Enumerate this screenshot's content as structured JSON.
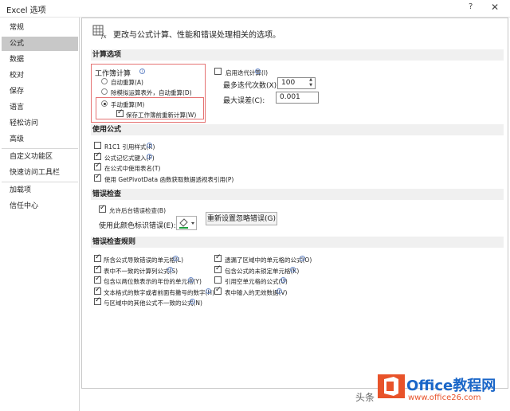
{
  "window": {
    "title": "Excel 选项",
    "help_label": "?",
    "close_label": "✕"
  },
  "sidebar": {
    "items": [
      {
        "label": "常规"
      },
      {
        "label": "公式"
      },
      {
        "label": "数据"
      },
      {
        "label": "校对"
      },
      {
        "label": "保存"
      },
      {
        "label": "语言"
      },
      {
        "label": "轻松访问"
      },
      {
        "label": "高级"
      },
      {
        "label": "自定义功能区"
      },
      {
        "label": "快速访问工具栏"
      },
      {
        "label": "加载项"
      },
      {
        "label": "信任中心"
      }
    ],
    "selected": "公式"
  },
  "header": {
    "text": "更改与公式计算、性能和错误处理相关的选项。",
    "icon": "formula-options-icon"
  },
  "calc": {
    "section_title": "计算选项",
    "workbook_calc_label": "工作簿计算",
    "auto": "自动重算(A)",
    "auto_except": "除模拟运算表外，自动重算(D)",
    "manual": "手动重算(M)",
    "recalc_before_save": "保存工作簿前重新计算(W)",
    "selected_mode": "manual",
    "iterative": "启用迭代计算(I)",
    "max_iter_label": "最多迭代次数(X):",
    "max_iter_value": "100",
    "max_change_label": "最大误差(C):",
    "max_change_value": "0.001"
  },
  "formulas": {
    "section_title": "使用公式",
    "items": [
      {
        "label": "R1C1 引用样式(R)",
        "checked": false
      },
      {
        "label": "公式记忆式键入(F)",
        "checked": true
      },
      {
        "label": "在公式中使用表名(T)",
        "checked": true
      },
      {
        "label": "使用 GetPivotData 函数获取数据透视表引用(P)",
        "checked": true
      }
    ]
  },
  "errcheck": {
    "section_title": "错误检查",
    "bg_check": "允许后台错误检查(B)",
    "color_label": "使用此颜色标识错误(E):",
    "reset_button": "重新设置忽略错误(G)"
  },
  "rules": {
    "section_title": "错误检查规则",
    "left": [
      {
        "label": "所含公式导致错误的单元格(L)",
        "checked": true
      },
      {
        "label": "表中不一致的计算列公式(S)",
        "checked": true
      },
      {
        "label": "包含以两位数表示的年份的单元格(Y)",
        "checked": true
      },
      {
        "label": "文本格式的数字或者前面有撇号的数字(H)",
        "checked": true
      },
      {
        "label": "与区域中的其他公式不一致的公式(N)",
        "checked": true
      }
    ],
    "right": [
      {
        "label": "遗漏了区域中的单元格的公式(O)",
        "checked": true
      },
      {
        "label": "包含公式的未锁定单元格(K)",
        "checked": true
      },
      {
        "label": "引用空单元格的公式(U)",
        "checked": false
      },
      {
        "label": "表中输入的无效数据(V)",
        "checked": true
      }
    ]
  },
  "watermark": {
    "prefix": "头条",
    "brand": "Office教程网",
    "url": "www.office26.com"
  },
  "colors": {
    "accent": "#e57373",
    "selected_bg": "#c8c8c8",
    "section_bg": "#f0f0f0"
  }
}
